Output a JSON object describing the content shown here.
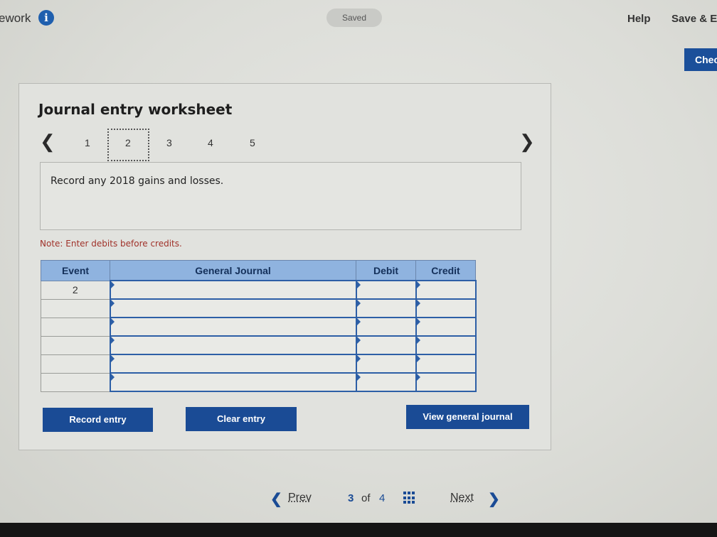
{
  "header": {
    "title": "ework",
    "saved_label": "Saved",
    "help_label": "Help",
    "save_exit_label": "Save & Ex",
    "check_label": "Chec"
  },
  "worksheet": {
    "title": "Journal entry worksheet",
    "pages": [
      "1",
      "2",
      "3",
      "4",
      "5"
    ],
    "selected_page": "2",
    "instruction": "Record any 2018 gains and losses.",
    "note": "Note: Enter debits before credits."
  },
  "journal": {
    "columns": [
      "Event",
      "General Journal",
      "Debit",
      "Credit"
    ],
    "rows": [
      {
        "event": "2"
      },
      {
        "event": ""
      },
      {
        "event": ""
      },
      {
        "event": ""
      },
      {
        "event": ""
      },
      {
        "event": ""
      }
    ]
  },
  "buttons": {
    "record": "Record entry",
    "clear": "Clear entry",
    "view": "View general journal"
  },
  "footer": {
    "prev": "Prev",
    "current": "3",
    "of": "of",
    "total": "4",
    "next": "Next"
  },
  "colors": {
    "accent": "#1a4b95",
    "table_header": "#8fb3df",
    "note_text": "#a0322a"
  }
}
